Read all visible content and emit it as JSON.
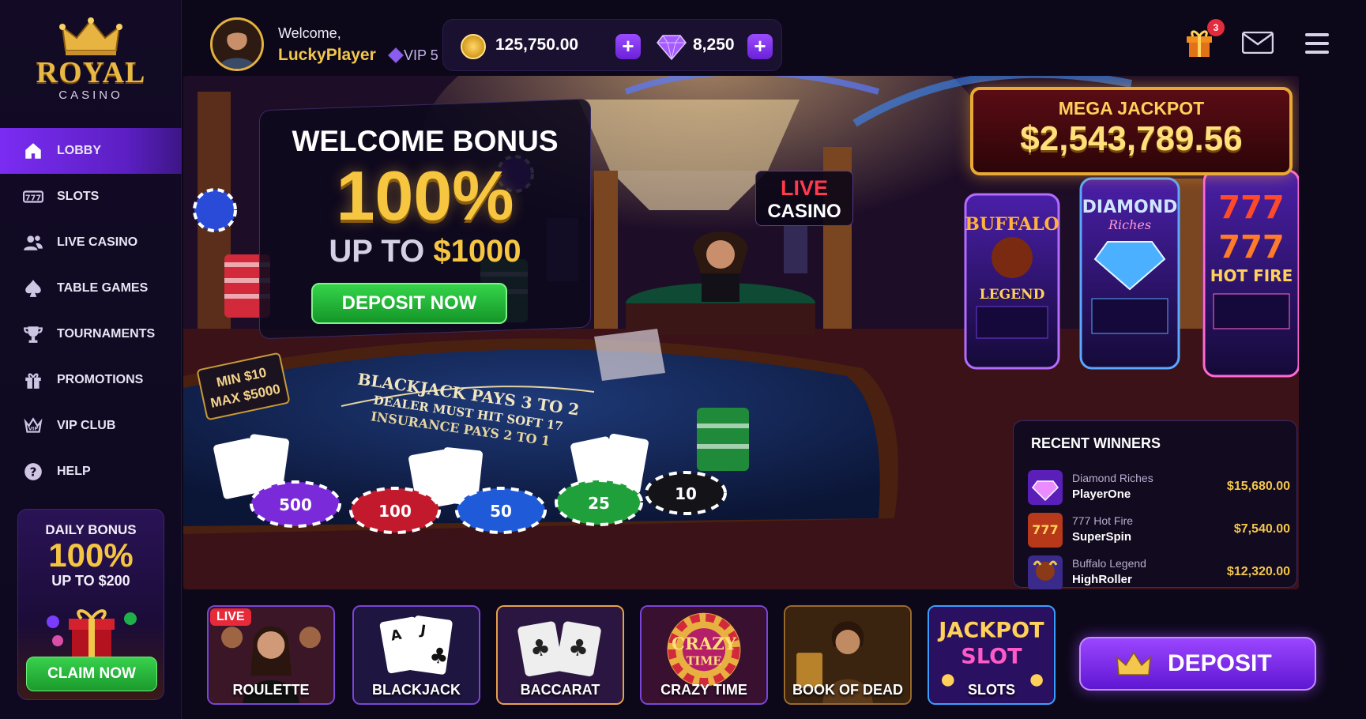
{
  "brand": {
    "name": "ROYAL",
    "sub": "CASINO"
  },
  "user": {
    "greeting": "Welcome,",
    "name": "LuckyPlayer",
    "vip": "VIP 5"
  },
  "wallet": {
    "coins": "125,750.00",
    "gems": "8,250"
  },
  "notifications": {
    "gift_count": "3"
  },
  "nav": {
    "items": [
      {
        "label": "LOBBY",
        "icon": "home-icon"
      },
      {
        "label": "SLOTS",
        "icon": "slots-icon"
      },
      {
        "label": "LIVE CASINO",
        "icon": "users-icon"
      },
      {
        "label": "TABLE GAMES",
        "icon": "spade-icon"
      },
      {
        "label": "TOURNAMENTS",
        "icon": "trophy-icon"
      },
      {
        "label": "PROMOTIONS",
        "icon": "gift-icon"
      },
      {
        "label": "VIP CLUB",
        "icon": "vip-crown-icon"
      },
      {
        "label": "HELP",
        "icon": "help-icon"
      }
    ]
  },
  "daily_bonus": {
    "title": "DAILY BONUS",
    "percent": "100%",
    "upto": "UP TO $200",
    "cta": "CLAIM NOW"
  },
  "hero": {
    "welcome_title": "WELCOME BONUS",
    "welcome_percent": "100%",
    "upto_text": "UP TO",
    "upto_amount": "$1000",
    "cta": "DEPOSIT NOW",
    "live_l1": "LIVE",
    "live_l2": "CASINO",
    "jackpot_title": "MEGA JACKPOT",
    "jackpot_amount": "$2,543,789.56",
    "min": "MIN $10",
    "max": "MAX $5000"
  },
  "winners": {
    "title": "RECENT WINNERS",
    "rows": [
      {
        "game": "Diamond Riches",
        "user": "PlayerOne",
        "amount": "$15,680.00"
      },
      {
        "game": "777 Hot Fire",
        "user": "SuperSpin",
        "amount": "$7,540.00"
      },
      {
        "game": "Buffalo Legend",
        "user": "HighRoller",
        "amount": "$12,320.00"
      }
    ]
  },
  "games": [
    {
      "label": "ROULETTE",
      "tag": "LIVE"
    },
    {
      "label": "BLACKJACK"
    },
    {
      "label": "BACCARAT"
    },
    {
      "label": "CRAZY TIME"
    },
    {
      "label": "BOOK OF DEAD"
    },
    {
      "label": "SLOTS"
    }
  ],
  "deposit": {
    "label": "DEPOSIT"
  },
  "colors": {
    "accent": "#7b2cf2",
    "gold": "#f3c74d",
    "green": "#1b9a2c",
    "live_red": "#e62a3a"
  }
}
